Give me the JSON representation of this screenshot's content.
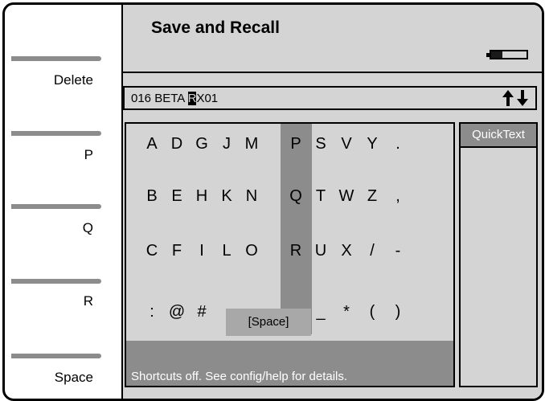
{
  "softkeys": [
    {
      "label": "Delete"
    },
    {
      "label": "P"
    },
    {
      "label": "Q"
    },
    {
      "label": "R"
    },
    {
      "label": "Space"
    }
  ],
  "header": {
    "title": "Save and Recall"
  },
  "name_field": {
    "prefix": "016 BETA ",
    "cursor_char": "R",
    "suffix": "X01",
    "arrows": "⇅"
  },
  "keyboard": {
    "rows": [
      [
        "A",
        "D",
        "G",
        "J",
        "M",
        "P",
        "S",
        "V",
        "Y",
        "."
      ],
      [
        "B",
        "E",
        "H",
        "K",
        "N",
        "Q",
        "T",
        "W",
        "Z",
        ","
      ],
      [
        "C",
        "F",
        "I",
        "L",
        "O",
        "R",
        "U",
        "X",
        "/",
        "-"
      ],
      [
        ":",
        "@",
        "#",
        "",
        "",
        "",
        "_",
        "*",
        "(",
        ")"
      ]
    ],
    "space_label": "[Space]",
    "highlighted_column": "P Q R"
  },
  "status": {
    "text": "Shortcuts off. See config/help for details."
  },
  "quicktext": {
    "label": "QuickText"
  },
  "colors": {
    "panel": "#d4d4d4",
    "highlight": "#8c8c8c",
    "border": "#000000"
  }
}
